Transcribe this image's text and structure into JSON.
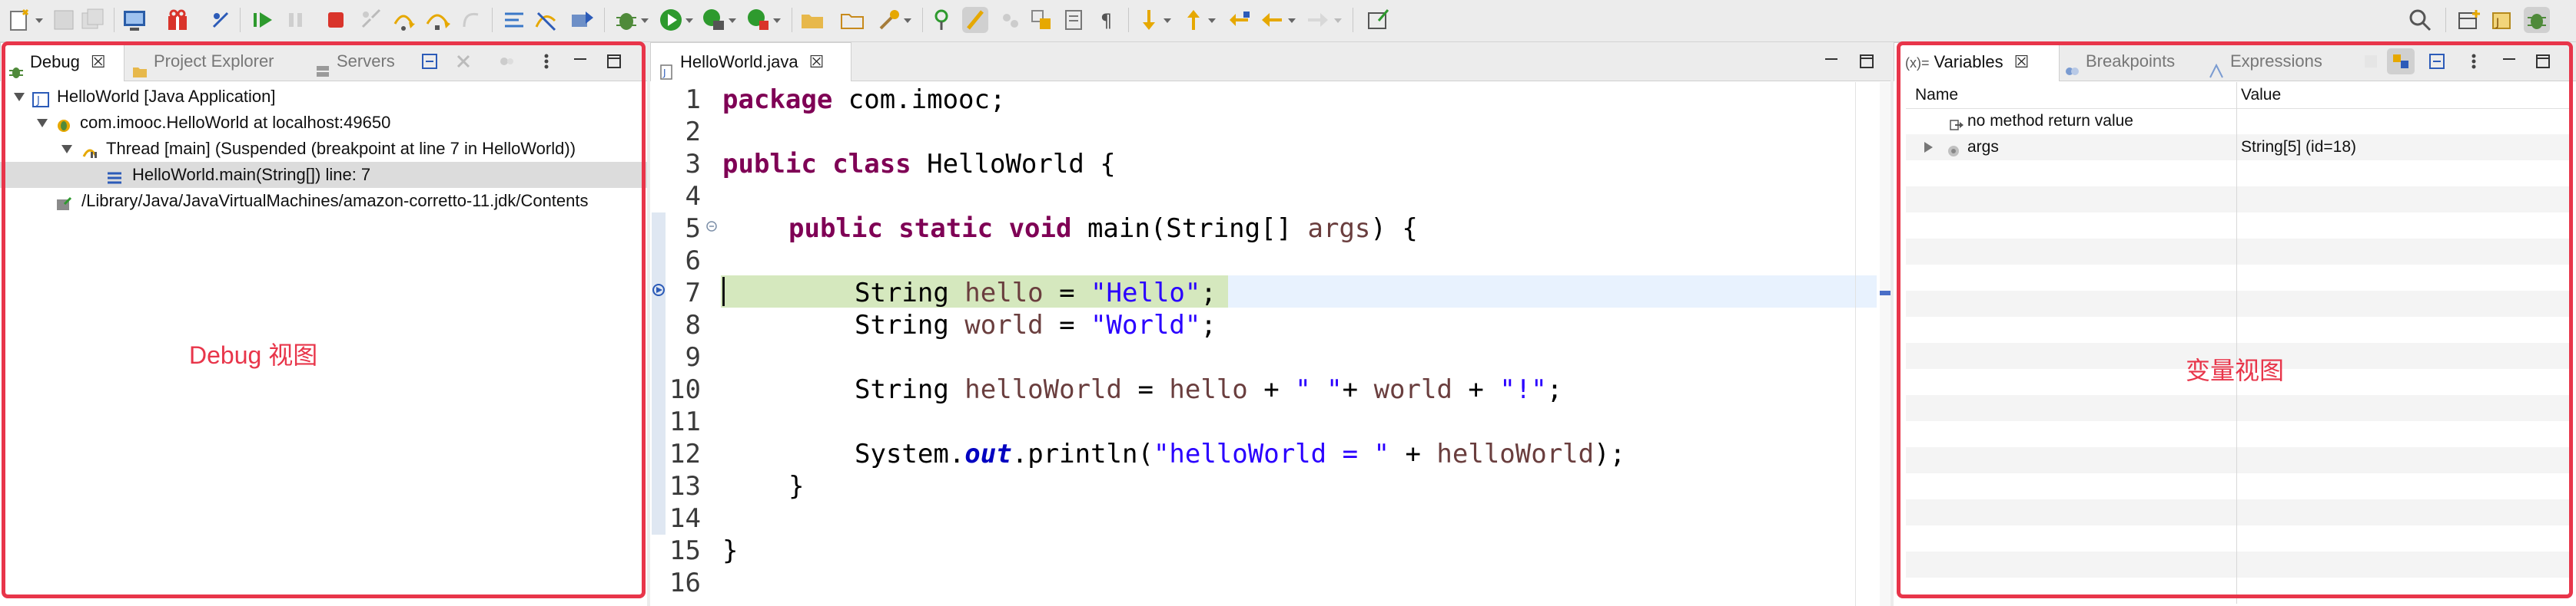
{
  "debug_panel": {
    "tabs": [
      {
        "label": "Debug",
        "active": true
      },
      {
        "label": "Project Explorer",
        "active": false
      },
      {
        "label": "Servers",
        "active": false
      }
    ],
    "tree": {
      "launch": "HelloWorld [Java Application]",
      "vm": "com.imooc.HelloWorld at localhost:49650",
      "thread": "Thread [main] (Suspended (breakpoint at line 7 in HelloWorld))",
      "frame": "HelloWorld.main(String[]) line: 7",
      "jdk": "/Library/Java/JavaVirtualMachines/amazon-corretto-11.jdk/Contents"
    },
    "annotation": "Debug 视图"
  },
  "editor": {
    "tab_label": "HelloWorld.java",
    "lines": [
      {
        "n": "1"
      },
      {
        "n": "2"
      },
      {
        "n": "3"
      },
      {
        "n": "4"
      },
      {
        "n": "5"
      },
      {
        "n": "6"
      },
      {
        "n": "7"
      },
      {
        "n": "8"
      },
      {
        "n": "9"
      },
      {
        "n": "10"
      },
      {
        "n": "11"
      },
      {
        "n": "12"
      },
      {
        "n": "13"
      },
      {
        "n": "14"
      },
      {
        "n": "15"
      },
      {
        "n": "16"
      }
    ],
    "code": {
      "l1_kw": "package",
      "l1_rest": " com.imooc;",
      "l3_kw": "public class",
      "l3_rest": " HelloWorld {",
      "l5_kw": "public static void",
      "l5_a": " main(String[] ",
      "l5_var": "args",
      "l5_b": ") {",
      "l7_a": "String ",
      "l7_var": "hello",
      "l7_b": " = ",
      "l7_str": "\"Hello\"",
      "l7_c": ";",
      "l8_a": "String ",
      "l8_var": "world",
      "l8_b": " = ",
      "l8_str": "\"World\"",
      "l8_c": ";",
      "l10_a": "String ",
      "l10_var": "helloWorld",
      "l10_b": " = ",
      "l10_v2": "hello",
      "l10_c": " + ",
      "l10_s1": "\" \"",
      "l10_d": "+ ",
      "l10_v3": "world",
      "l10_e": " + ",
      "l10_s2": "\"!\"",
      "l10_f": ";",
      "l12_a": "System.",
      "l12_fld": "out",
      "l12_b": ".println(",
      "l12_str": "\"helloWorld = \"",
      "l12_c": " + ",
      "l12_var": "helloWorld",
      "l12_d": ");",
      "l13": "}",
      "l15": "}"
    }
  },
  "variables_panel": {
    "tabs": [
      {
        "label": "Variables",
        "active": true
      },
      {
        "label": "Breakpoints",
        "active": false
      },
      {
        "label": "Expressions",
        "active": false
      }
    ],
    "var_tab_prefix": "(x)=",
    "columns": {
      "name": "Name",
      "value": "Value"
    },
    "rows": [
      {
        "name": "no method return value",
        "value": ""
      },
      {
        "name": "args",
        "value": "String[5]  (id=18)"
      }
    ],
    "annotation": "变量视图"
  },
  "colors": {
    "accent_red": "#e8354a",
    "current_line": "#d5e8be",
    "keyword": "#7f0055",
    "string": "#2a00ff"
  }
}
